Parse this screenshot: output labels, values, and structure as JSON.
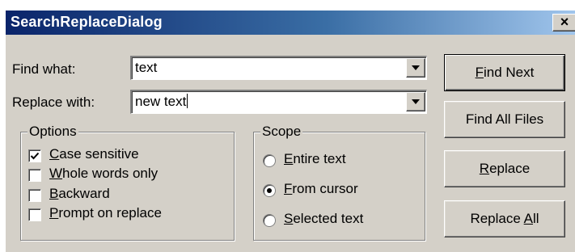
{
  "dialog": {
    "title": "SearchReplaceDialog",
    "close_label": "×"
  },
  "find": {
    "label_prefix": "",
    "label_hotkey": "",
    "label_rest": "Find what:",
    "value": "text"
  },
  "replace": {
    "label_prefix": "",
    "label_hotkey": "",
    "label_rest": "Replace with:",
    "value": "new text"
  },
  "options": {
    "title": "Options",
    "items": [
      {
        "hotkey": "C",
        "rest": "ase sensitive",
        "checked": true
      },
      {
        "hotkey": "W",
        "rest": "hole words only",
        "checked": false
      },
      {
        "hotkey": "B",
        "rest": "ackward",
        "checked": false
      },
      {
        "hotkey": "P",
        "rest": "rompt on replace",
        "checked": false
      }
    ]
  },
  "scope": {
    "title": "Scope",
    "items": [
      {
        "hotkey": "E",
        "rest": "ntire text",
        "selected": false
      },
      {
        "hotkey": "F",
        "rest": "rom cursor",
        "selected": true
      },
      {
        "hotkey": "S",
        "rest": "elected text",
        "selected": false
      }
    ]
  },
  "buttons": {
    "find_next": {
      "pre": "",
      "hotkey": "F",
      "rest": "ind Next"
    },
    "find_all_files": {
      "pre": "Find All Files",
      "hotkey": "",
      "rest": ""
    },
    "replace": {
      "pre": "",
      "hotkey": "R",
      "rest": "eplace"
    },
    "replace_all": {
      "pre": "Replace ",
      "hotkey": "A",
      "rest": "ll"
    }
  }
}
